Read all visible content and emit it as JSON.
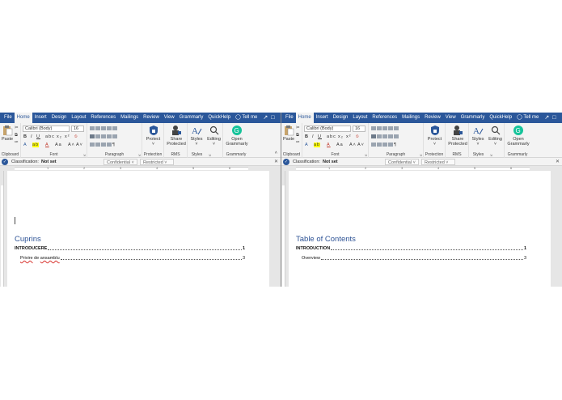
{
  "menu": {
    "items": [
      "File",
      "Home",
      "Insert",
      "Design",
      "Layout",
      "References",
      "Mailings",
      "Review",
      "View",
      "Grammarly",
      "QuickHelp"
    ],
    "tell_me": "Tell me"
  },
  "ribbon": {
    "clipboard": {
      "paste": "Paste",
      "group": "Clipboard"
    },
    "font": {
      "name": "Calibri (Body)",
      "size": "16",
      "group": "Font"
    },
    "paragraph": {
      "group": "Paragraph"
    },
    "protection": {
      "protect": "Protect",
      "group": "Protection"
    },
    "rms": {
      "share_line1": "Share",
      "share_line2": "Protected",
      "group": "RMS"
    },
    "styles": {
      "styles": "Styles",
      "editing": "Editing",
      "group": "Styles"
    },
    "grammarly": {
      "open_line1": "Open",
      "open_line2": "Grammarly",
      "group": "Grammarly"
    }
  },
  "classification": {
    "label": "Classification:",
    "value": "Not set",
    "confidential": "Confidential",
    "restricted": "Restricted"
  },
  "ruler_numbers": [
    "1",
    "2",
    "3",
    "4",
    "5",
    "6"
  ],
  "left_doc": {
    "title": "Cuprins",
    "entry1_label": "INTRODUCERE",
    "entry1_page": "1",
    "entry2_word1": "Privire",
    "entry2_word2": " de ",
    "entry2_word3": "ansamblu",
    "entry2_page": "3"
  },
  "right_doc": {
    "title": "Table of Contents",
    "entry1_label": "INTRODUCTION",
    "entry1_page": "1",
    "entry2_label": "Overview",
    "entry2_page": "3"
  },
  "colors": {
    "word_blue": "#2b579a",
    "heading_blue": "#2f5496",
    "grammarly_green": "#15c39a"
  }
}
